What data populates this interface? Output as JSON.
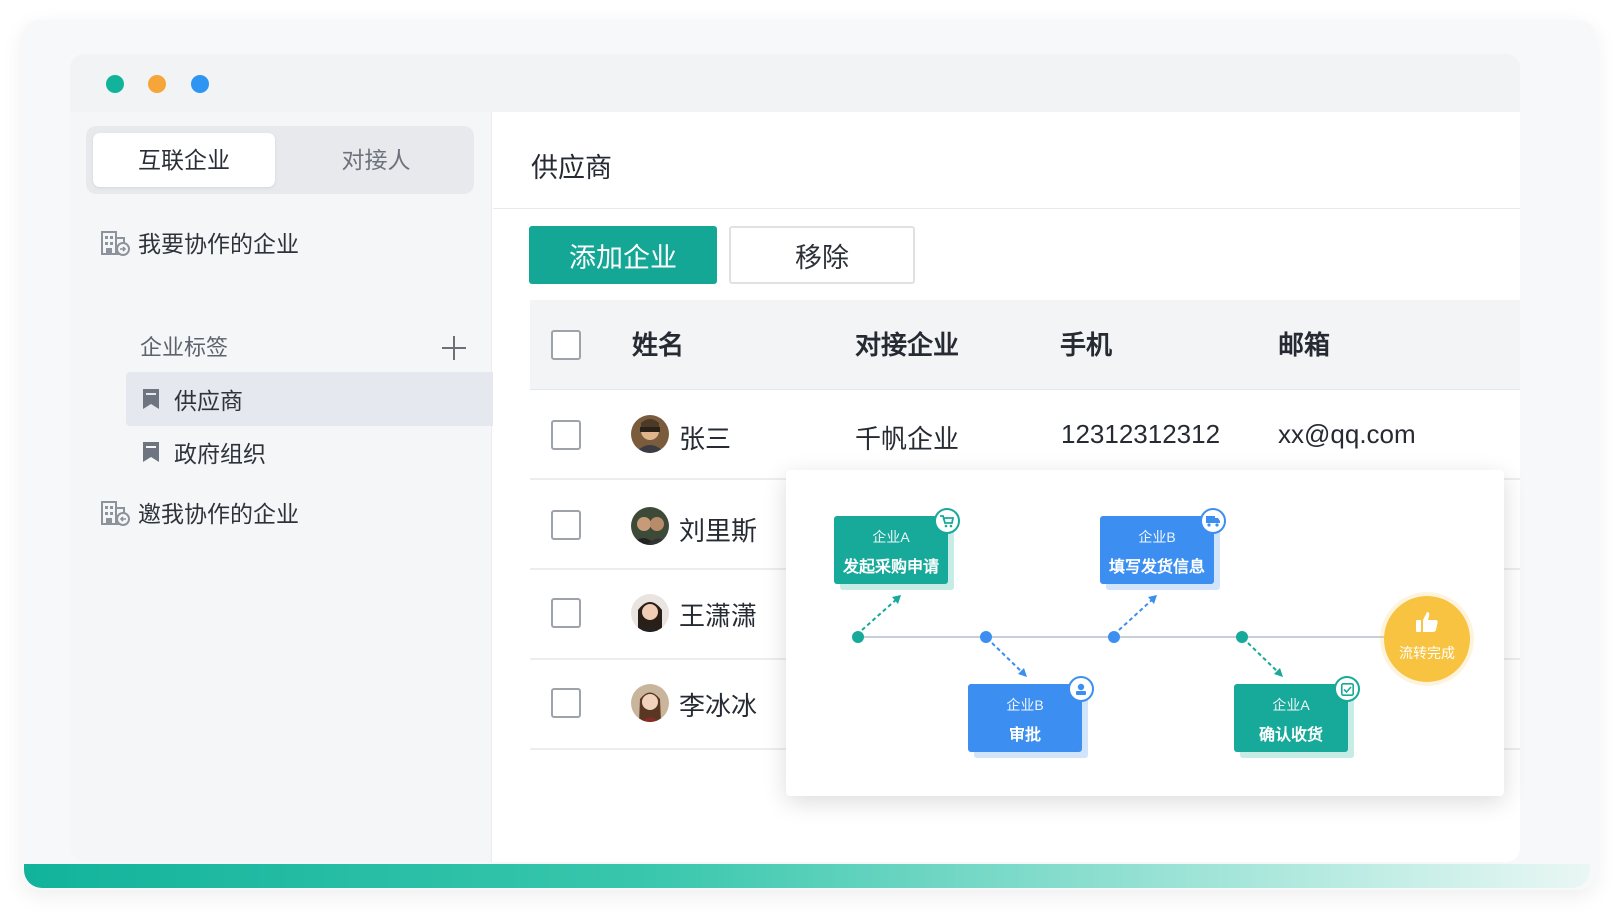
{
  "colors": {
    "accent": "#14a795",
    "window_dots": [
      "#12b39b",
      "#f5a53a",
      "#2f95f2"
    ],
    "flow_teal": "#17a999",
    "flow_blue": "#3c8ff0",
    "flow_done": "#f7c340"
  },
  "sidebar": {
    "segment_tabs": [
      {
        "label": "互联企业",
        "active": true
      },
      {
        "label": "对接人",
        "active": false
      }
    ],
    "group_collaborate": {
      "label": "我要协作的企业",
      "icon": "building-share-icon"
    },
    "tags_header": {
      "label": "企业标签",
      "add_icon": "plus-icon"
    },
    "tags": [
      {
        "label": "供应商",
        "icon": "bookmark-icon",
        "active": true
      },
      {
        "label": "政府组织",
        "icon": "bookmark-icon",
        "active": false
      }
    ],
    "group_invited": {
      "label": "邀我协作的企业",
      "icon": "building-share-icon"
    }
  },
  "main": {
    "title": "供应商",
    "buttons": {
      "add": "添加企业",
      "remove": "移除"
    },
    "table": {
      "columns": [
        "姓名",
        "对接企业",
        "手机",
        "邮箱"
      ],
      "rows": [
        {
          "name": "张三",
          "company": "千帆企业",
          "phone": "12312312312",
          "email": "xx@qq.com"
        },
        {
          "name": "刘里斯",
          "company": "",
          "phone": "",
          "email": ""
        },
        {
          "name": "王潇潇",
          "company": "",
          "phone": "",
          "email": ""
        },
        {
          "name": "李冰冰",
          "company": "",
          "phone": "",
          "email": ""
        }
      ]
    }
  },
  "flow": {
    "steps": [
      {
        "company": "企业A",
        "action": "发起采购申请",
        "icon": "cart-icon"
      },
      {
        "company": "企业B",
        "action": "审批",
        "icon": "user-stamp-icon"
      },
      {
        "company": "企业B",
        "action": "填写发货信息",
        "icon": "truck-icon"
      },
      {
        "company": "企业A",
        "action": "确认收货",
        "icon": "check-box-icon"
      }
    ],
    "done": {
      "label": "流转完成",
      "icon": "thumbs-up-icon"
    }
  }
}
